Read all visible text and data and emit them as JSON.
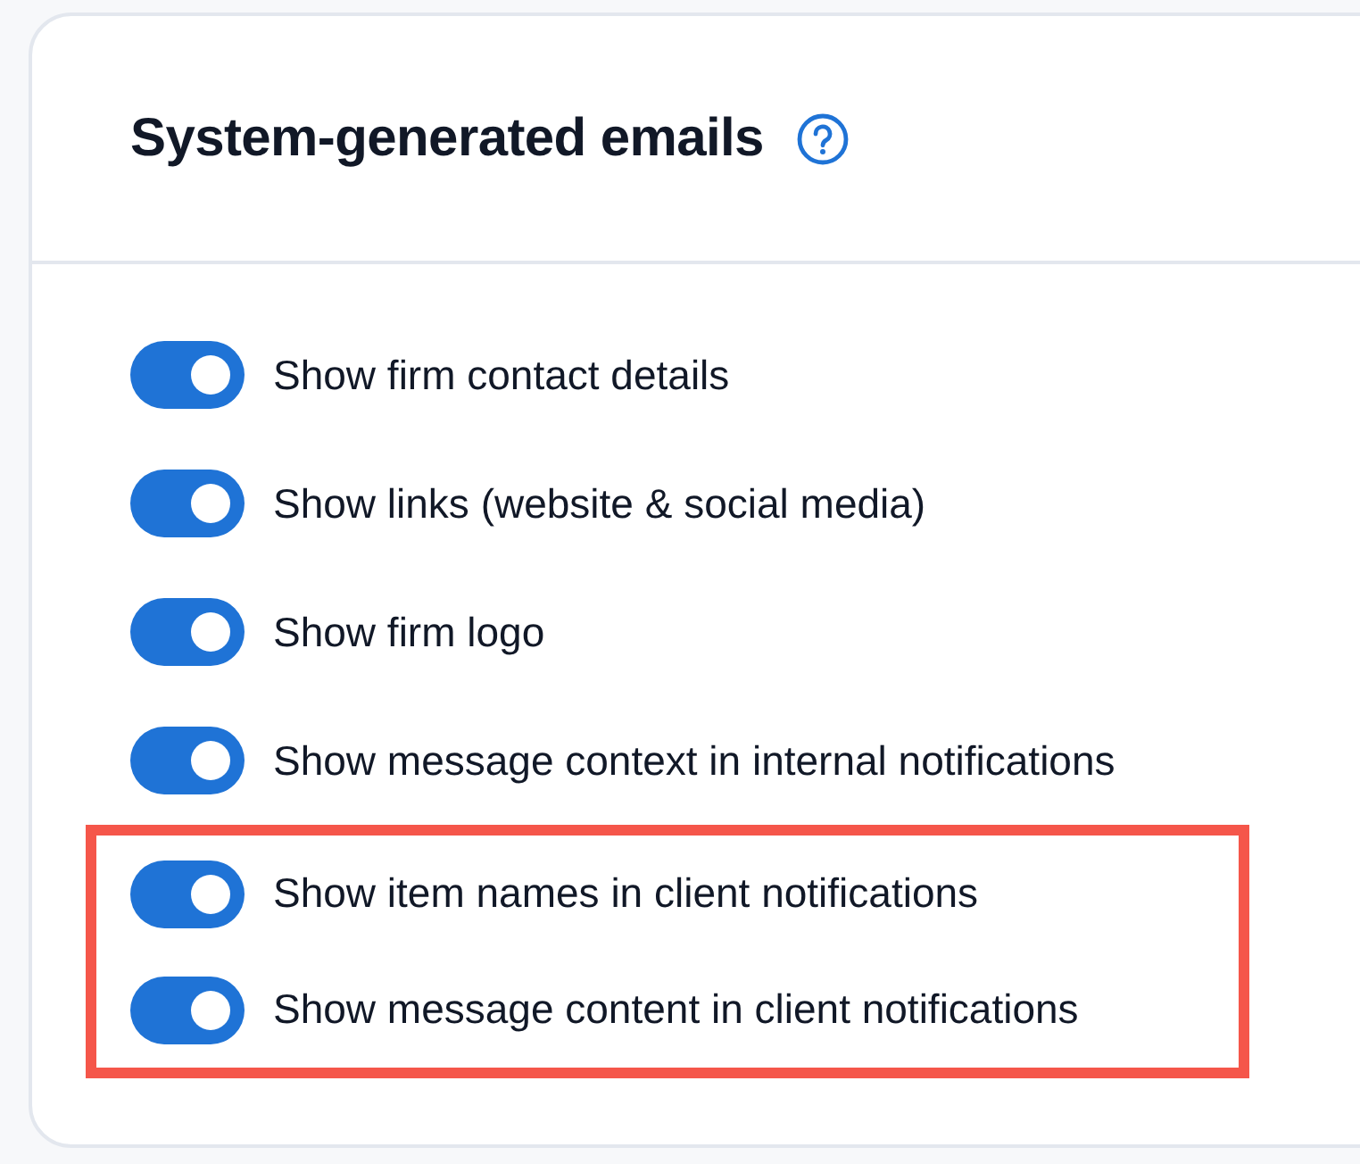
{
  "card": {
    "title": "System-generated emails",
    "toggles": [
      {
        "label": "Show firm contact details",
        "on": true
      },
      {
        "label": "Show links (website & social media)",
        "on": true
      },
      {
        "label": "Show firm logo",
        "on": true
      },
      {
        "label": "Show message context in internal notifications",
        "on": true
      }
    ],
    "highlighted_toggles": [
      {
        "label": "Show item names in client notifications",
        "on": true
      },
      {
        "label": "Show message content in client notifications",
        "on": true
      }
    ]
  }
}
